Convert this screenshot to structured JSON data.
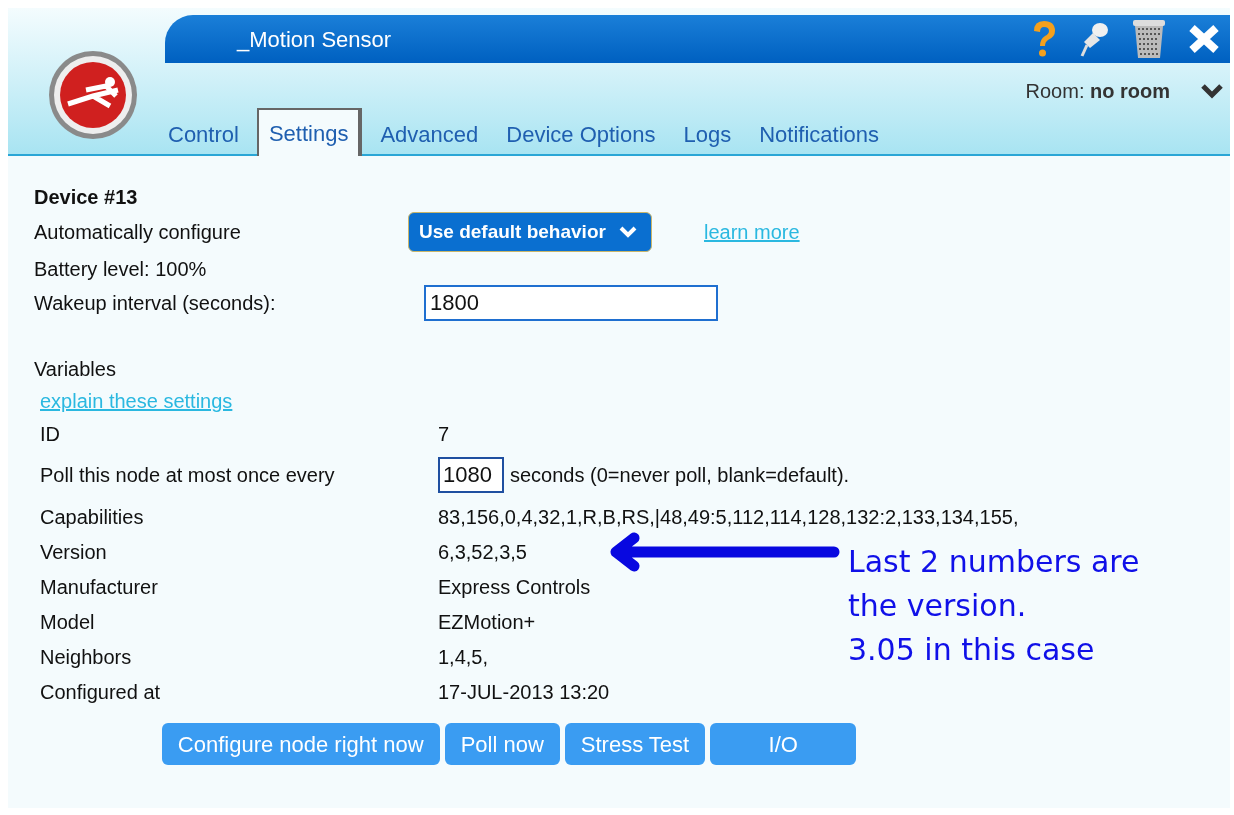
{
  "window": {
    "title": "_Motion Sensor",
    "room_label": "Room:",
    "room_value": "no room"
  },
  "tabs": [
    {
      "label": "Control",
      "selected": false
    },
    {
      "label": "Settings",
      "selected": true
    },
    {
      "label": "Advanced",
      "selected": false
    },
    {
      "label": "Device Options",
      "selected": false
    },
    {
      "label": "Logs",
      "selected": false
    },
    {
      "label": "Notifications",
      "selected": false
    }
  ],
  "device": {
    "heading": "Device #13",
    "auto_configure_label": "Automatically configure",
    "auto_configure_value": "Use default behavior",
    "learn_more": "learn more",
    "battery": "Battery level: 100%",
    "wakeup_label": "Wakeup interval (seconds):",
    "wakeup_value": "1800"
  },
  "variables": {
    "heading": "Variables",
    "explain_link": "explain these settings",
    "rows": [
      {
        "kind": "text",
        "label": "ID",
        "value": "7"
      },
      {
        "kind": "input",
        "label": "Poll this node at most once every",
        "value": "1080",
        "suffix": "seconds (0=never poll, blank=default)."
      },
      {
        "kind": "text",
        "label": "Capabilities",
        "value": "83,156,0,4,32,1,R,B,RS,|48,49:5,112,114,128,132:2,133,134,155,"
      },
      {
        "kind": "text",
        "label": "Version",
        "value": "6,3,52,3,5"
      },
      {
        "kind": "text",
        "label": "Manufacturer",
        "value": "Express Controls"
      },
      {
        "kind": "text",
        "label": "Model",
        "value": "EZMotion+"
      },
      {
        "kind": "text",
        "label": "Neighbors",
        "value": "1,4,5,"
      },
      {
        "kind": "text",
        "label": "Configured at",
        "value": "17-JUL-2013 13:20"
      }
    ]
  },
  "buttons": [
    "Configure node right now",
    "Poll now",
    "Stress Test",
    "I/O"
  ],
  "annotation": {
    "lines": [
      "Last 2 numbers are",
      "the version.",
      "3.05 in this case"
    ]
  }
}
